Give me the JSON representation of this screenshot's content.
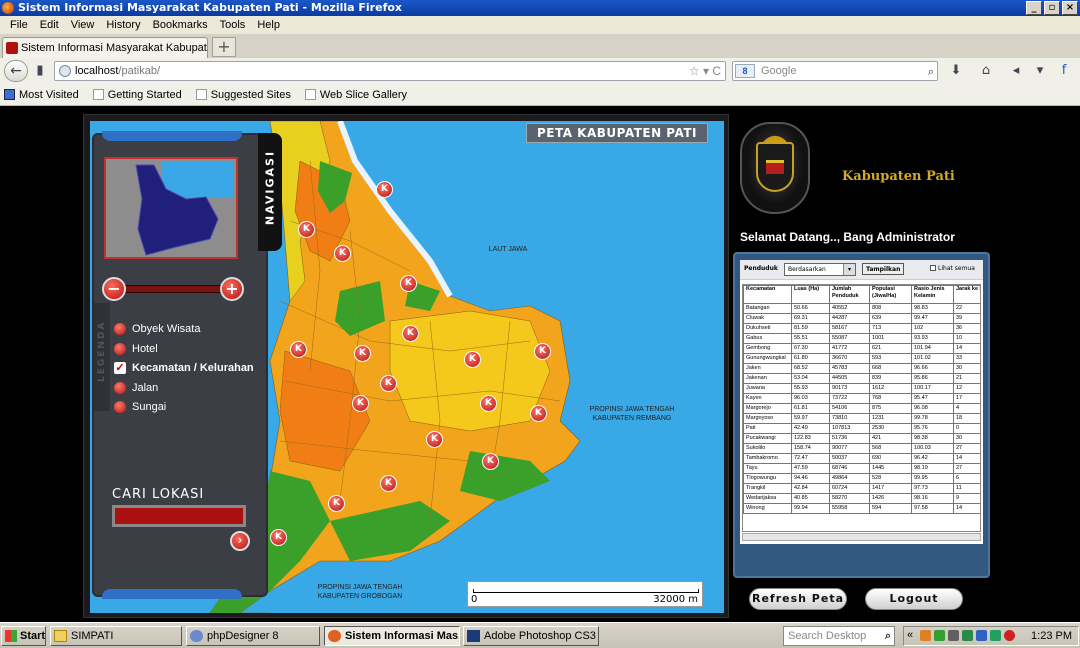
{
  "window": {
    "title": "Sistem Informasi Masyarakat Kabupaten Pati - Mozilla Firefox",
    "controls": [
      "_",
      "▫",
      "×"
    ]
  },
  "menu": [
    "File",
    "Edit",
    "View",
    "History",
    "Bookmarks",
    "Tools",
    "Help"
  ],
  "tab": {
    "label": "Sistem Informasi Masyarakat Kabupaten Pati",
    "new_tab": "+"
  },
  "nav": {
    "back": "←",
    "url_host": "localhost",
    "url_path": "/patikab/",
    "url_tail": "☆ ▾ C",
    "search_engine": "8",
    "search_placeholder": "Google",
    "search_icon": "⌕"
  },
  "bookmarks": [
    "Most Visited",
    "Getting Started",
    "Suggested Sites",
    "Web Slice Gallery"
  ],
  "map": {
    "title": "PETA KABUPATEN PATI",
    "navigasi": "NAVIGASI",
    "legenda": "LEGENDA",
    "labels": {
      "sea": "LAUT JAWA",
      "east": "PROPINSI JAWA TENGAH\nKABUPATEN REMBANG",
      "south": "PROPINSI JAWA TENGAH\nKABUPATEN GROBOGAN"
    },
    "scale_start": "0",
    "scale_end": "32000 m",
    "zoom_out": "−",
    "zoom_in": "+",
    "marker_letter": "K"
  },
  "legend": [
    {
      "label": "Obyek Wisata",
      "checked": false
    },
    {
      "label": "Hotel",
      "checked": false
    },
    {
      "label": "Kecamatan / Kelurahan",
      "checked": true
    },
    {
      "label": "Jalan",
      "checked": false
    },
    {
      "label": "Sungai",
      "checked": false
    }
  ],
  "search": {
    "title": "CARI LOKASI",
    "go": "›"
  },
  "header": {
    "brand": "Kabupaten Pati",
    "welcome": "Selamat Datang.., Bang Administrator"
  },
  "filter": {
    "label": "Penduduk",
    "select_value": "Berdasarkan",
    "button": "Tampilkan",
    "checkbox_label": "Lihat semua"
  },
  "table": {
    "columns": [
      "Kecamatan",
      "Luas (Ha)",
      "Jumlah Penduduk",
      "Populasi (Jiwa/Ha)",
      "Rasio Jenis Kelamin",
      "Jarak ke Kota"
    ],
    "rows": [
      [
        "Batangan",
        "50.66",
        "40552",
        "808",
        "98.83",
        "22"
      ],
      [
        "Cluwak",
        "69.31",
        "44287",
        "639",
        "99.47",
        "39"
      ],
      [
        "Dukuhseti",
        "81.59",
        "58167",
        "713",
        "102",
        "36"
      ],
      [
        "Gabus",
        "55.51",
        "55087",
        "1001",
        "93.93",
        "10"
      ],
      [
        "Gembong",
        "67.30",
        "41772",
        "621",
        "101.94",
        "14"
      ],
      [
        "Gunungwungkal",
        "61.80",
        "36670",
        "593",
        "101.02",
        "33"
      ],
      [
        "Jaken",
        "68.52",
        "45783",
        "668",
        "96.66",
        "30"
      ],
      [
        "Jakenan",
        "53.04",
        "44505",
        "839",
        "95.86",
        "21"
      ],
      [
        "Juwana",
        "55.93",
        "90173",
        "1612",
        "100.17",
        "12"
      ],
      [
        "Kayen",
        "96.03",
        "73722",
        "768",
        "95.47",
        "17"
      ],
      [
        "Margorejo",
        "61.81",
        "54106",
        "875",
        "96.08",
        "4"
      ],
      [
        "Margoyoso",
        "59.97",
        "73810",
        "1231",
        "99.78",
        "18"
      ],
      [
        "Pati",
        "42.49",
        "107813",
        "2530",
        "95.76",
        "0"
      ],
      [
        "Pucakwangi",
        "122.83",
        "51736",
        "421",
        "98.38",
        "30"
      ],
      [
        "Sukolilo",
        "158.74",
        "90077",
        "568",
        "100.03",
        "27"
      ],
      [
        "Tambakromo",
        "72.47",
        "50037",
        "690",
        "96.42",
        "14"
      ],
      [
        "Tayu",
        "47.59",
        "68746",
        "1445",
        "98.19",
        "27"
      ],
      [
        "Tlogowungu",
        "94.46",
        "49864",
        "528",
        "99.95",
        "6"
      ],
      [
        "Trangkil",
        "42.84",
        "60724",
        "1417",
        "97.73",
        "11"
      ],
      [
        "Wedarijaksa",
        "40.85",
        "58270",
        "1426",
        "98.16",
        "9"
      ],
      [
        "Winong",
        "99.94",
        "55958",
        "594",
        "97.58",
        "14"
      ]
    ]
  },
  "buttons": {
    "refresh": "Refresh Peta",
    "logout": "Logout"
  },
  "taskbar": {
    "start": "Start",
    "tasks": [
      "SIMPATI",
      "phpDesigner 8",
      "Sistem Informasi Mas...",
      "Adobe Photoshop CS3"
    ],
    "search_placeholder": "Search Desktop",
    "search_icon": "⌕",
    "tray_expand": "«",
    "clock": "1:23 PM"
  }
}
